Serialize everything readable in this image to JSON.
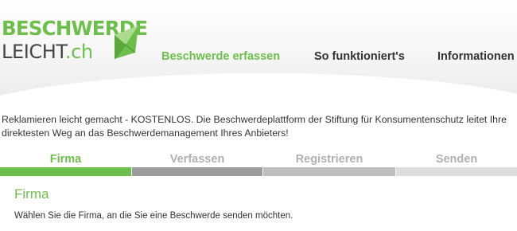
{
  "logo": {
    "line1": "BESCHWERDE",
    "line2_main": "LEICHT",
    "line2_tld": ".ch",
    "icon": "envelope-icon"
  },
  "nav": {
    "items": [
      {
        "label": "Beschwerde erfassen",
        "active": true
      },
      {
        "label": "So funktioniert's",
        "active": false
      },
      {
        "label": "Informationen",
        "active": false
      }
    ]
  },
  "intro": {
    "text": "Reklamieren leicht gemacht - KOSTENLOS. Die Beschwerdeplattform der Stiftung für Konsumentenschutz leitet Ihre direktesten Weg an das Beschwerdemanagement Ihres Anbieters!"
  },
  "steps": [
    {
      "label": "Firma",
      "state": "active"
    },
    {
      "label": "Verfassen",
      "state": "pending"
    },
    {
      "label": "Registrieren",
      "state": "pending"
    },
    {
      "label": "Senden",
      "state": "pending"
    }
  ],
  "section": {
    "title": "Firma",
    "text": "Wählen Sie die Firma, an die Sie eine Beschwerde senden möchten."
  },
  "colors": {
    "brand_green": "#6cbf4a",
    "text": "#333333",
    "step_active": "#6cbf4a",
    "step_bars": [
      "#6cbf4a",
      "#9c9c9c",
      "#bdbdbd",
      "#dddddd"
    ]
  }
}
